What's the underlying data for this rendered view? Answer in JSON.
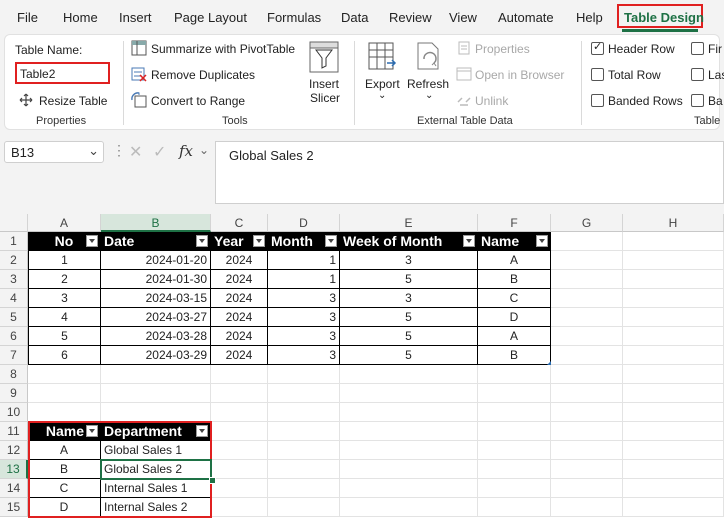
{
  "menu": {
    "file": "File",
    "home": "Home",
    "insert": "Insert",
    "page_layout": "Page Layout",
    "formulas": "Formulas",
    "data": "Data",
    "review": "Review",
    "view": "View",
    "automate": "Automate",
    "help": "Help",
    "table_design": "Table Design"
  },
  "ribbon": {
    "table_name_label": "Table Name:",
    "table_name_value": "Table2",
    "resize_table": "Resize Table",
    "properties_group": "Properties",
    "summarize_pivot": "Summarize with PivotTable",
    "remove_duplicates": "Remove Duplicates",
    "convert_to_range": "Convert to Range",
    "insert_slicer_1": "Insert",
    "insert_slicer_2": "Slicer",
    "tools_group": "Tools",
    "export": "Export",
    "refresh": "Refresh",
    "properties": "Properties",
    "open_in_browser": "Open in Browser",
    "unlink": "Unlink",
    "external_group": "External Table Data",
    "header_row": "Header Row",
    "total_row": "Total Row",
    "banded_rows": "Banded Rows",
    "first_col_cut": "Fir",
    "last_col_cut": "Las",
    "banded_col_cut": "Ba",
    "table_style_group_cut": "Table"
  },
  "formula_bar": {
    "cell_ref": "B13",
    "content": "Global Sales 2",
    "fx": "fx"
  },
  "columns": [
    "A",
    "B",
    "C",
    "D",
    "E",
    "F",
    "G",
    "H"
  ],
  "rows": [
    "1",
    "2",
    "3",
    "4",
    "5",
    "6",
    "7",
    "8",
    "9",
    "10",
    "11",
    "12",
    "13",
    "14",
    "15"
  ],
  "table1": {
    "headers": [
      "No",
      "Date",
      "Year",
      "Month",
      "Week of Month",
      "Name"
    ],
    "rows": [
      [
        "1",
        "2024-01-20",
        "2024",
        "1",
        "3",
        "A"
      ],
      [
        "2",
        "2024-01-30",
        "2024",
        "1",
        "5",
        "B"
      ],
      [
        "3",
        "2024-03-15",
        "2024",
        "3",
        "3",
        "C"
      ],
      [
        "4",
        "2024-03-27",
        "2024",
        "3",
        "5",
        "D"
      ],
      [
        "5",
        "2024-03-28",
        "2024",
        "3",
        "5",
        "A"
      ],
      [
        "6",
        "2024-03-29",
        "2024",
        "3",
        "5",
        "B"
      ]
    ]
  },
  "table2": {
    "headers": [
      "Name",
      "Department"
    ],
    "rows": [
      [
        "A",
        "Global Sales 1"
      ],
      [
        "B",
        "Global Sales 2"
      ],
      [
        "C",
        "Internal Sales 1"
      ],
      [
        "D",
        "Internal Sales 2"
      ]
    ]
  },
  "colors": {
    "accent": "#1e7145",
    "highlight": "#e02020",
    "header_fill": "#000000"
  }
}
